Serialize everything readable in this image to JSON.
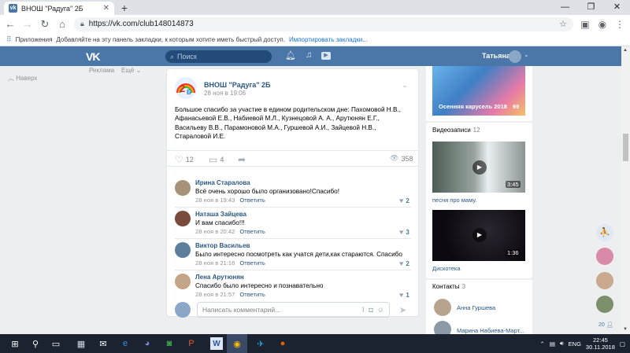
{
  "browser": {
    "tab_title": "ВНОШ \"Радуга\" 2Б",
    "new_tab": "+",
    "url": "https://vk.com/club148014873",
    "bookmarks": {
      "apps": "Приложения",
      "hint": "Добавляйте на эту панель закладки, к которым хотите иметь быстрый доступ.",
      "import": "Импортировать закладки..."
    }
  },
  "header": {
    "logo": "VK",
    "search_placeholder": "Поиск",
    "user_name": "Татьяна"
  },
  "left": {
    "ads": "Реклама",
    "more": "Ещё",
    "back": "Наверх"
  },
  "post": {
    "group_name": "ВНОШ \"Радуга\" 2Б",
    "date": "28 ноя в 19:06",
    "text": "Большое спасибо за участие в едином родительском дне: Пахомовой Н.В., Афанасьевой Е.В., Набиевой М.Л., Кузнецовой А. А., Арутюнян Е.Г., Васильеву В.В., Парамоновой М.А., Гуршевой А.И., Зайцевой Н.В., Стараловой И.Е.",
    "likes": "12",
    "comments": "4",
    "views": "358"
  },
  "comments": [
    {
      "name": "Ирина Старалова",
      "text": "Всё очень хорошо было организовано!Спасибо!",
      "date": "28 ноя в 19:43",
      "reply": "Ответить",
      "likes": "2"
    },
    {
      "name": "Наташа Зайцева",
      "text": "И вам спасибо!!!",
      "date": "28 ноя в 20:42",
      "reply": "Ответить",
      "likes": "3"
    },
    {
      "name": "Виктор Васильев",
      "text": "Было интересно посмотреть как учатся дети,как стараются. Спасибо",
      "date": "28 ноя в 21:16",
      "reply": "Ответить",
      "likes": "2"
    },
    {
      "name": "Лена Арутюнян",
      "text": "Спасибо было интересно и познавательно",
      "date": "28 ноя в 21:57",
      "reply": "Ответить",
      "likes": "1"
    }
  ],
  "comment_input_placeholder": "Написать комментарий...",
  "right": {
    "album_caption": "Осенняя карусель 2018",
    "album_count": "69",
    "videos_title": "Видеозаписи",
    "videos_count": "12",
    "videos": [
      {
        "title": "песня про маму.",
        "duration": "3:45"
      },
      {
        "title": "Дискотека",
        "duration": "1:36"
      }
    ],
    "contacts_title": "Контакты",
    "contacts_count": "3",
    "contacts": [
      "Анна Гуршева",
      "Марина Набиева-Март..."
    ]
  },
  "chat": {
    "count": "20"
  },
  "taskbar": {
    "lang": "ENG",
    "time": "22:45",
    "date": "30.11.2018"
  },
  "colors": {
    "vk_blue": "#4a76a8",
    "link": "#2a5885",
    "page_bg": "#edeef0"
  }
}
